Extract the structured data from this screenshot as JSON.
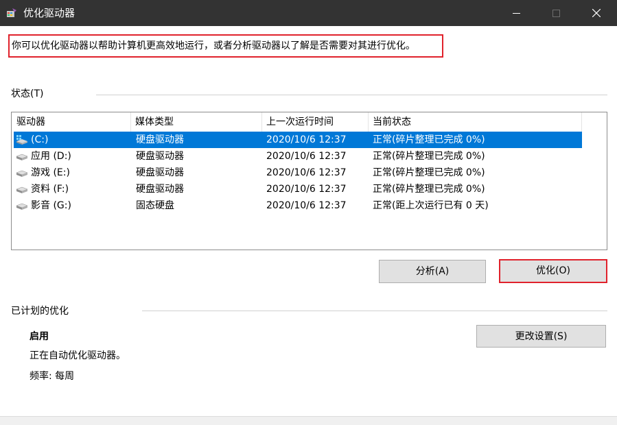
{
  "window": {
    "title": "优化驱动器"
  },
  "description": "你可以优化驱动器以帮助计算机更高效地运行，或者分析驱动器以了解是否需要对其进行优化。",
  "status_section": {
    "label": "状态(T)"
  },
  "table": {
    "columns": [
      "驱动器",
      "媒体类型",
      "上一次运行时间",
      "当前状态"
    ],
    "rows": [
      {
        "drive": "(C:)",
        "media": "硬盘驱动器",
        "last_run": "2020/10/6 12:37",
        "status": "正常(碎片整理已完成 0%)",
        "icon": "windows-drive-icon",
        "selected": true
      },
      {
        "drive": "应用 (D:)",
        "media": "硬盘驱动器",
        "last_run": "2020/10/6 12:37",
        "status": "正常(碎片整理已完成 0%)",
        "icon": "drive-icon",
        "selected": false
      },
      {
        "drive": "游戏 (E:)",
        "media": "硬盘驱动器",
        "last_run": "2020/10/6 12:37",
        "status": "正常(碎片整理已完成 0%)",
        "icon": "drive-icon",
        "selected": false
      },
      {
        "drive": "资料 (F:)",
        "media": "硬盘驱动器",
        "last_run": "2020/10/6 12:37",
        "status": "正常(碎片整理已完成 0%)",
        "icon": "drive-icon",
        "selected": false
      },
      {
        "drive": "影音 (G:)",
        "media": "固态硬盘",
        "last_run": "2020/10/6 12:37",
        "status": "正常(距上次运行已有 0 天)",
        "icon": "drive-icon",
        "selected": false
      }
    ]
  },
  "buttons": {
    "analyze": "分析(A)",
    "optimize": "优化(O)",
    "change_settings": "更改设置(S)"
  },
  "scheduled": {
    "label": "已计划的优化",
    "state": "启用",
    "detail": "正在自动优化驱动器。",
    "frequency": "频率: 每周"
  },
  "colors": {
    "selection": "#0078d7",
    "highlight_border": "#e0212b",
    "titlebar": "#333333"
  }
}
